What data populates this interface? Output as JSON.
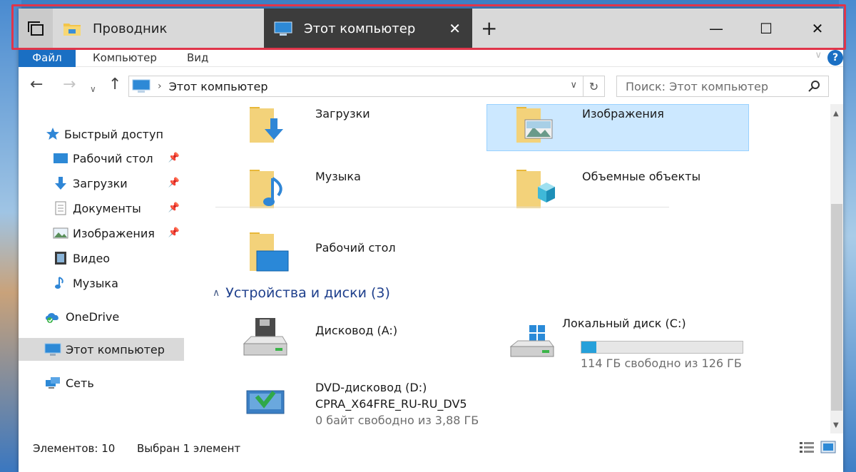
{
  "tabs": {
    "tab1_label": "Проводник",
    "tab2_label": "Этот компьютер",
    "new_tab": "+",
    "close_tab": "✕"
  },
  "window_controls": {
    "minimize": "—",
    "maximize": "☐",
    "close": "✕"
  },
  "ribbon": {
    "file": "Файл",
    "computer": "Компьютер",
    "view": "Вид",
    "help": "?"
  },
  "address": {
    "path": "Этот компьютер",
    "search_placeholder": "Поиск: Этот компьютер"
  },
  "nav_pane": {
    "quick_access": "Быстрый доступ",
    "items": [
      {
        "label": "Рабочий стол",
        "icon": "desktop-icon",
        "pinned": true
      },
      {
        "label": "Загрузки",
        "icon": "downloads-icon",
        "pinned": true
      },
      {
        "label": "Документы",
        "icon": "documents-icon",
        "pinned": true
      },
      {
        "label": "Изображения",
        "icon": "pictures-icon",
        "pinned": true
      },
      {
        "label": "Видео",
        "icon": "video-icon",
        "pinned": false
      },
      {
        "label": "Музыка",
        "icon": "music-icon",
        "pinned": false
      }
    ],
    "onedrive": "OneDrive",
    "this_pc": "Этот компьютер",
    "network": "Сеть"
  },
  "folders": [
    {
      "name": "Загрузки",
      "icon": "downloads-folder-icon"
    },
    {
      "name": "Изображения",
      "icon": "pictures-folder-icon",
      "selected": true
    },
    {
      "name": "Музыка",
      "icon": "music-folder-icon"
    },
    {
      "name": "Объемные объекты",
      "icon": "3d-objects-folder-icon"
    },
    {
      "name": "Рабочий стол",
      "icon": "desktop-folder-icon"
    }
  ],
  "devices": {
    "group_title": "Устройства и диски (3)",
    "items": [
      {
        "name": "Дисковод (A:)",
        "icon": "floppy-drive-icon"
      },
      {
        "name": "Локальный диск (C:)",
        "icon": "windows-drive-icon",
        "usage_fraction": 0.095,
        "sub": "114 ГБ свободно из 126 ГБ"
      },
      {
        "name": "DVD-дисковод (D:)",
        "label": "CPRA_X64FRE_RU-RU_DV5",
        "icon": "dvd-drive-icon",
        "sub": "0 байт свободно из 3,88 ГБ"
      }
    ]
  },
  "status": {
    "count": "Элементов: 10",
    "selected": "Выбран 1 элемент"
  },
  "colors": {
    "accent": "#1a6fc3",
    "selection": "#cce8ff",
    "highlight_frame": "#e0354a"
  }
}
